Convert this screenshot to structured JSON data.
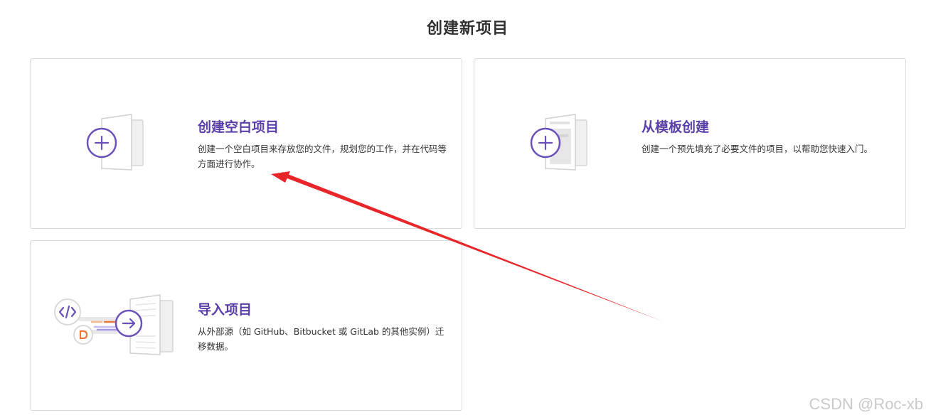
{
  "page": {
    "title": "创建新项目"
  },
  "cards": {
    "blank": {
      "title": "创建空白项目",
      "description": "创建一个空白项目来存放您的文件，规划您的工作，并在代码等方面进行协作。",
      "icon": "plus-circle-icon"
    },
    "template": {
      "title": "从模板创建",
      "description": "创建一个预先填充了必要文件的项目，以帮助您快速入门。",
      "icon": "plus-circle-icon"
    },
    "import": {
      "title": "导入项目",
      "description": "从外部源（如 GitHub、Bitbucket 或 GitLab 的其他实例）迁移数据。",
      "icon": "arrow-right-circle-icon"
    }
  },
  "colors": {
    "accent": "#6b4fbb",
    "title": "#5a3fa8",
    "annotation": "#e8262a",
    "orange": "#e8783b"
  },
  "watermark": {
    "text": "CSDN @Roc-xb"
  }
}
